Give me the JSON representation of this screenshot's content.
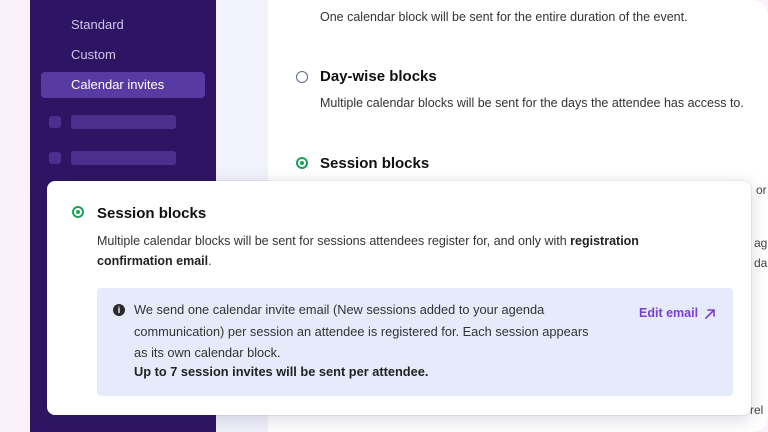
{
  "sidebar": {
    "items": [
      {
        "label": "Standard"
      },
      {
        "label": "Custom"
      },
      {
        "label": "Calendar invites"
      }
    ]
  },
  "content": {
    "top_desc": "One calendar block will be sent for the entire duration of the event.",
    "options": [
      {
        "title": "Day-wise blocks",
        "desc": "Multiple calendar blocks will be sent for the days the attendee has access to."
      },
      {
        "title": "Session blocks"
      }
    ],
    "edge_fragments": [
      "or",
      "ag",
      "da",
      "rel"
    ]
  },
  "popup": {
    "title": "Session blocks",
    "desc_prefix": "Multiple calendar blocks will be sent for sessions attendees register for, and only with ",
    "desc_bold": "registration confirmation email",
    "desc_suffix": ".",
    "info_icon": "i",
    "info_text": "We send one calendar invite email (New sessions added to your agenda communication) per session an attendee is registered for. Each session appears as its own calendar block.",
    "info_bold": "Up to 7 session invites will be sent per attendee.",
    "edit_label": "Edit email"
  },
  "colors": {
    "sidebar_bg": "#2d1563",
    "sidebar_active": "#583aa3",
    "radio_selected": "#1aa35a",
    "link": "#7a3fd6",
    "info_bg": "#e5ebfb"
  }
}
